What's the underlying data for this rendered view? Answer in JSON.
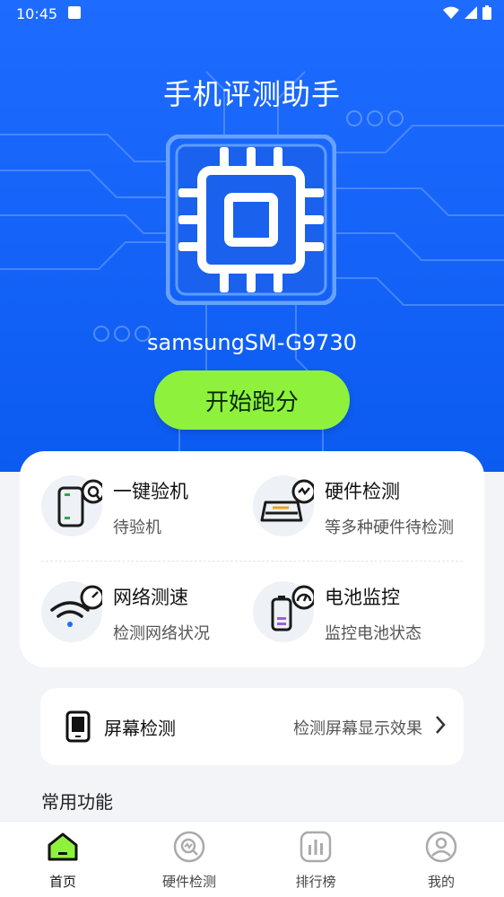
{
  "status_bar": {
    "time": "10:45"
  },
  "header": {
    "title": "手机评测助手"
  },
  "device": {
    "model": "samsungSM-G9730"
  },
  "actions": {
    "start_label": "开始跑分"
  },
  "features": [
    {
      "name": "一键验机",
      "desc": "待验机",
      "icon": "phone-check-icon"
    },
    {
      "name": "硬件检测",
      "desc": "等多种硬件待检测",
      "icon": "hardware-search-icon"
    },
    {
      "name": "网络测速",
      "desc": "检测网络状况",
      "icon": "wifi-speed-icon"
    },
    {
      "name": "电池监控",
      "desc": "监控电池状态",
      "icon": "battery-gauge-icon"
    }
  ],
  "screen_test": {
    "label": "屏幕检测",
    "desc": "检测屏幕显示效果"
  },
  "section": {
    "common_title": "常用功能"
  },
  "tabs": [
    {
      "label": "首页",
      "icon": "home-icon",
      "active": true
    },
    {
      "label": "硬件检测",
      "icon": "hardware-check-icon",
      "active": false
    },
    {
      "label": "排行榜",
      "icon": "ranking-icon",
      "active": false
    },
    {
      "label": "我的",
      "icon": "profile-icon",
      "active": false
    }
  ],
  "colors": {
    "primary": "#1e6bff",
    "accent": "#8ef23d",
    "feature_icon": "#2ea84d"
  }
}
